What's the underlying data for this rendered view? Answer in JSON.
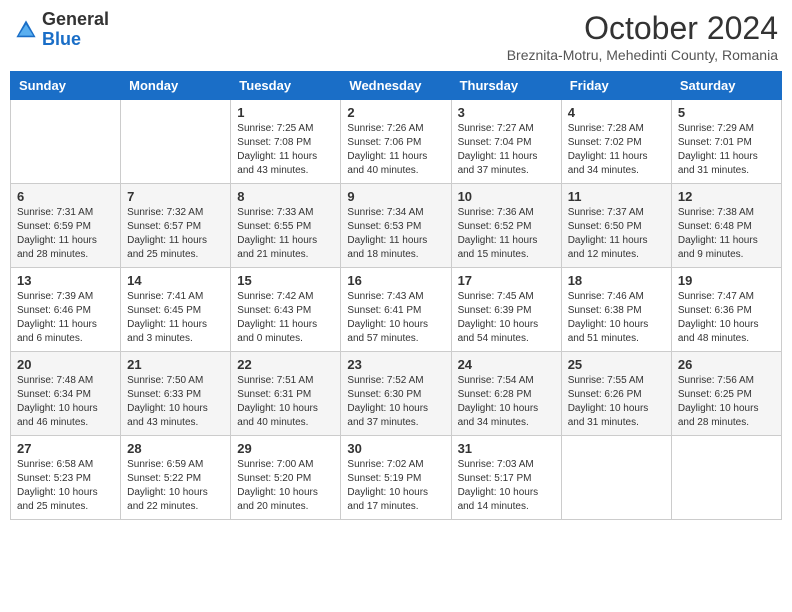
{
  "logo": {
    "general": "General",
    "blue": "Blue"
  },
  "title": "October 2024",
  "subtitle": "Breznita-Motru, Mehedinti County, Romania",
  "days_of_week": [
    "Sunday",
    "Monday",
    "Tuesday",
    "Wednesday",
    "Thursday",
    "Friday",
    "Saturday"
  ],
  "weeks": [
    [
      {
        "day": null
      },
      {
        "day": null
      },
      {
        "day": "1",
        "sunrise": "7:25 AM",
        "sunset": "7:08 PM",
        "daylight": "11 hours and 43 minutes."
      },
      {
        "day": "2",
        "sunrise": "7:26 AM",
        "sunset": "7:06 PM",
        "daylight": "11 hours and 40 minutes."
      },
      {
        "day": "3",
        "sunrise": "7:27 AM",
        "sunset": "7:04 PM",
        "daylight": "11 hours and 37 minutes."
      },
      {
        "day": "4",
        "sunrise": "7:28 AM",
        "sunset": "7:02 PM",
        "daylight": "11 hours and 34 minutes."
      },
      {
        "day": "5",
        "sunrise": "7:29 AM",
        "sunset": "7:01 PM",
        "daylight": "11 hours and 31 minutes."
      }
    ],
    [
      {
        "day": "6",
        "sunrise": "7:31 AM",
        "sunset": "6:59 PM",
        "daylight": "11 hours and 28 minutes."
      },
      {
        "day": "7",
        "sunrise": "7:32 AM",
        "sunset": "6:57 PM",
        "daylight": "11 hours and 25 minutes."
      },
      {
        "day": "8",
        "sunrise": "7:33 AM",
        "sunset": "6:55 PM",
        "daylight": "11 hours and 21 minutes."
      },
      {
        "day": "9",
        "sunrise": "7:34 AM",
        "sunset": "6:53 PM",
        "daylight": "11 hours and 18 minutes."
      },
      {
        "day": "10",
        "sunrise": "7:36 AM",
        "sunset": "6:52 PM",
        "daylight": "11 hours and 15 minutes."
      },
      {
        "day": "11",
        "sunrise": "7:37 AM",
        "sunset": "6:50 PM",
        "daylight": "11 hours and 12 minutes."
      },
      {
        "day": "12",
        "sunrise": "7:38 AM",
        "sunset": "6:48 PM",
        "daylight": "11 hours and 9 minutes."
      }
    ],
    [
      {
        "day": "13",
        "sunrise": "7:39 AM",
        "sunset": "6:46 PM",
        "daylight": "11 hours and 6 minutes."
      },
      {
        "day": "14",
        "sunrise": "7:41 AM",
        "sunset": "6:45 PM",
        "daylight": "11 hours and 3 minutes."
      },
      {
        "day": "15",
        "sunrise": "7:42 AM",
        "sunset": "6:43 PM",
        "daylight": "11 hours and 0 minutes."
      },
      {
        "day": "16",
        "sunrise": "7:43 AM",
        "sunset": "6:41 PM",
        "daylight": "10 hours and 57 minutes."
      },
      {
        "day": "17",
        "sunrise": "7:45 AM",
        "sunset": "6:39 PM",
        "daylight": "10 hours and 54 minutes."
      },
      {
        "day": "18",
        "sunrise": "7:46 AM",
        "sunset": "6:38 PM",
        "daylight": "10 hours and 51 minutes."
      },
      {
        "day": "19",
        "sunrise": "7:47 AM",
        "sunset": "6:36 PM",
        "daylight": "10 hours and 48 minutes."
      }
    ],
    [
      {
        "day": "20",
        "sunrise": "7:48 AM",
        "sunset": "6:34 PM",
        "daylight": "10 hours and 46 minutes."
      },
      {
        "day": "21",
        "sunrise": "7:50 AM",
        "sunset": "6:33 PM",
        "daylight": "10 hours and 43 minutes."
      },
      {
        "day": "22",
        "sunrise": "7:51 AM",
        "sunset": "6:31 PM",
        "daylight": "10 hours and 40 minutes."
      },
      {
        "day": "23",
        "sunrise": "7:52 AM",
        "sunset": "6:30 PM",
        "daylight": "10 hours and 37 minutes."
      },
      {
        "day": "24",
        "sunrise": "7:54 AM",
        "sunset": "6:28 PM",
        "daylight": "10 hours and 34 minutes."
      },
      {
        "day": "25",
        "sunrise": "7:55 AM",
        "sunset": "6:26 PM",
        "daylight": "10 hours and 31 minutes."
      },
      {
        "day": "26",
        "sunrise": "7:56 AM",
        "sunset": "6:25 PM",
        "daylight": "10 hours and 28 minutes."
      }
    ],
    [
      {
        "day": "27",
        "sunrise": "6:58 AM",
        "sunset": "5:23 PM",
        "daylight": "10 hours and 25 minutes."
      },
      {
        "day": "28",
        "sunrise": "6:59 AM",
        "sunset": "5:22 PM",
        "daylight": "10 hours and 22 minutes."
      },
      {
        "day": "29",
        "sunrise": "7:00 AM",
        "sunset": "5:20 PM",
        "daylight": "10 hours and 20 minutes."
      },
      {
        "day": "30",
        "sunrise": "7:02 AM",
        "sunset": "5:19 PM",
        "daylight": "10 hours and 17 minutes."
      },
      {
        "day": "31",
        "sunrise": "7:03 AM",
        "sunset": "5:17 PM",
        "daylight": "10 hours and 14 minutes."
      },
      {
        "day": null
      },
      {
        "day": null
      }
    ]
  ]
}
